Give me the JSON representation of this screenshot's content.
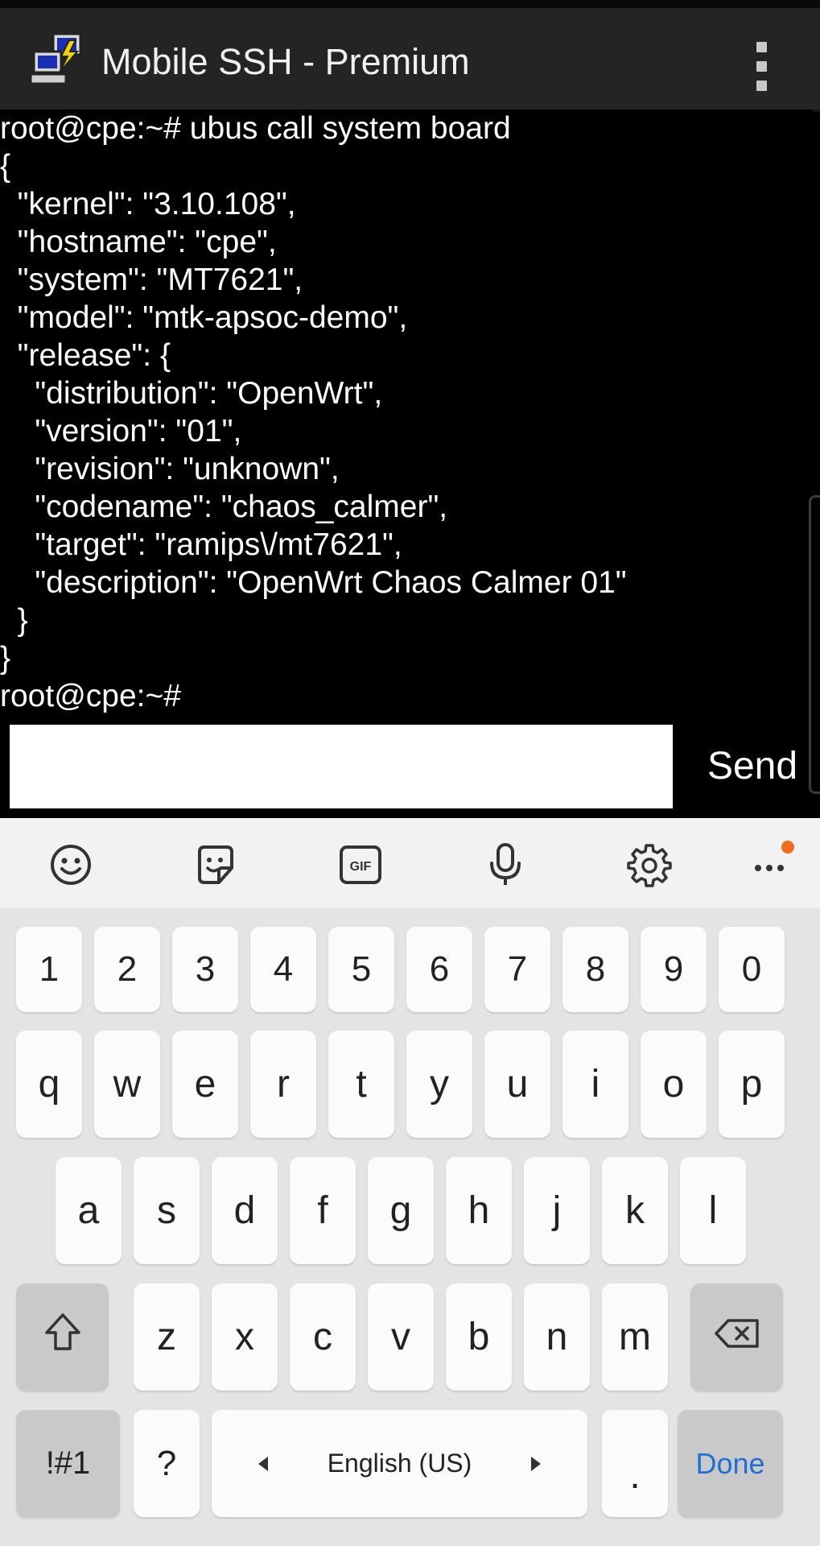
{
  "app": {
    "title": "Mobile SSH - Premium",
    "icon": "pc-connection-icon",
    "overflow_icon": "more-vertical-icon"
  },
  "terminal": {
    "lines": [
      "root@cpe:~# ubus call system board",
      "{",
      "  \"kernel\": \"3.10.108\",",
      "  \"hostname\": \"cpe\",",
      "  \"system\": \"MT7621\",",
      "  \"model\": \"mtk-apsoc-demo\",",
      "  \"release\": {",
      "    \"distribution\": \"OpenWrt\",",
      "    \"version\": \"01\",",
      "    \"revision\": \"unknown\",",
      "    \"codename\": \"chaos_calmer\",",
      "    \"target\": \"ramips\\/mt7621\",",
      "    \"description\": \"OpenWrt Chaos Calmer 01\"",
      "  }",
      "}",
      "root@cpe:~#"
    ]
  },
  "input": {
    "value": "",
    "send_label": "Send"
  },
  "keyboard": {
    "toolbar": [
      "emoji-icon",
      "sticker-icon",
      "gif-icon",
      "microphone-icon",
      "settings-gear-icon",
      "more-horizontal-icon"
    ],
    "gif_label": "GIF",
    "number_row": [
      "1",
      "2",
      "3",
      "4",
      "5",
      "6",
      "7",
      "8",
      "9",
      "0"
    ],
    "row1": [
      "q",
      "w",
      "e",
      "r",
      "t",
      "y",
      "u",
      "i",
      "o",
      "p"
    ],
    "row2": [
      "a",
      "s",
      "d",
      "f",
      "g",
      "h",
      "j",
      "k",
      "l"
    ],
    "row3": [
      "z",
      "x",
      "c",
      "v",
      "b",
      "n",
      "m"
    ],
    "shift_icon": "shift-arrow-icon",
    "backspace_icon": "backspace-icon",
    "symbols_label": "!#1",
    "question_label": "?",
    "space_label": "English (US)",
    "period_label": ".",
    "done_label": "Done",
    "accent_color": "#1f6fd6",
    "notification_color": "#f26a1b"
  }
}
